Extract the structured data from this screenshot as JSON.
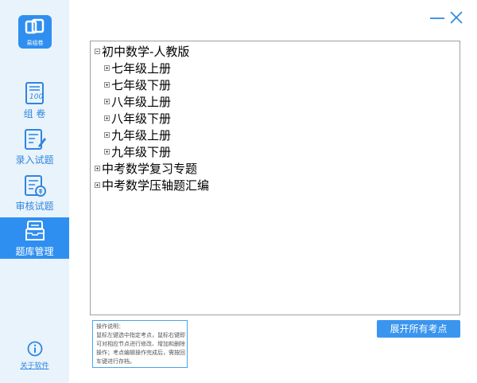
{
  "app": {
    "logo_text": "易组卷"
  },
  "sidebar": {
    "items": [
      {
        "label": "组  卷",
        "icon": "exam-paper-icon"
      },
      {
        "label": "录入试题",
        "icon": "edit-question-icon"
      },
      {
        "label": "审核试题",
        "icon": "review-question-icon"
      },
      {
        "label": "题库管理",
        "icon": "question-bank-icon",
        "active": true
      }
    ],
    "about_label": "关于软件"
  },
  "window": {
    "minimize_icon": "minimize-icon",
    "close_icon": "close-icon"
  },
  "tree": {
    "root": "初中数学-人教版",
    "children": [
      "七年级上册",
      "七年级下册",
      "八年级上册",
      "八年级下册",
      "九年级上册",
      "九年级下册"
    ],
    "siblings": [
      "中考数学复习专题",
      "中考数学压轴题汇编"
    ]
  },
  "hint": {
    "lines": [
      "操作说明：",
      "鼠标左键选中指定考点，鼠标右键即",
      "可对相应节点进行修改、增加和删除",
      "操作；考点编辑操作完成后，需按回",
      "车键进行存档。"
    ]
  },
  "actions": {
    "expand_all_label": "展开所有考点"
  },
  "colors": {
    "accent": "#2f8ff0",
    "sidebar_bg": "#e9f3fc",
    "nav_text": "#2f86de"
  }
}
